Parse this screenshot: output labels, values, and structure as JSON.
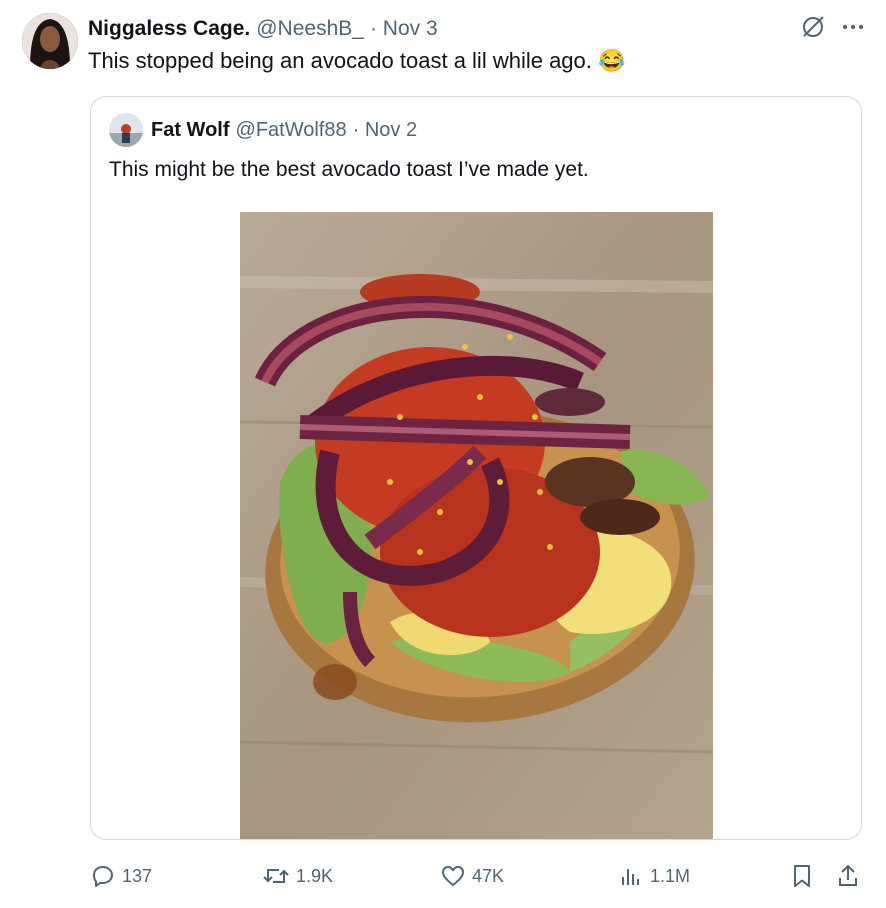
{
  "tweet": {
    "author_name": "Niggaless Cage.",
    "author_handle": "@NeeshB_",
    "date": "· Nov 3",
    "text": "This stopped being an avocado toast a lil while ago. 😂"
  },
  "quoted": {
    "author_name": "Fat Wolf",
    "author_handle": "@FatWolf88",
    "date": "· Nov 2",
    "text": "This might be the best avocado toast I’ve made yet."
  },
  "actions": {
    "replies": "137",
    "reposts": "1.9K",
    "likes": "47K",
    "views": "1.1M"
  },
  "icons": {
    "grok": "grok-icon",
    "more": "more-icon",
    "reply": "reply-icon",
    "repost": "repost-icon",
    "like": "heart-icon",
    "views": "views-icon",
    "bookmark": "bookmark-icon",
    "share": "share-icon"
  },
  "colors": {
    "text": "#0f1419",
    "muted": "#536471",
    "border": "#cfd9de"
  }
}
